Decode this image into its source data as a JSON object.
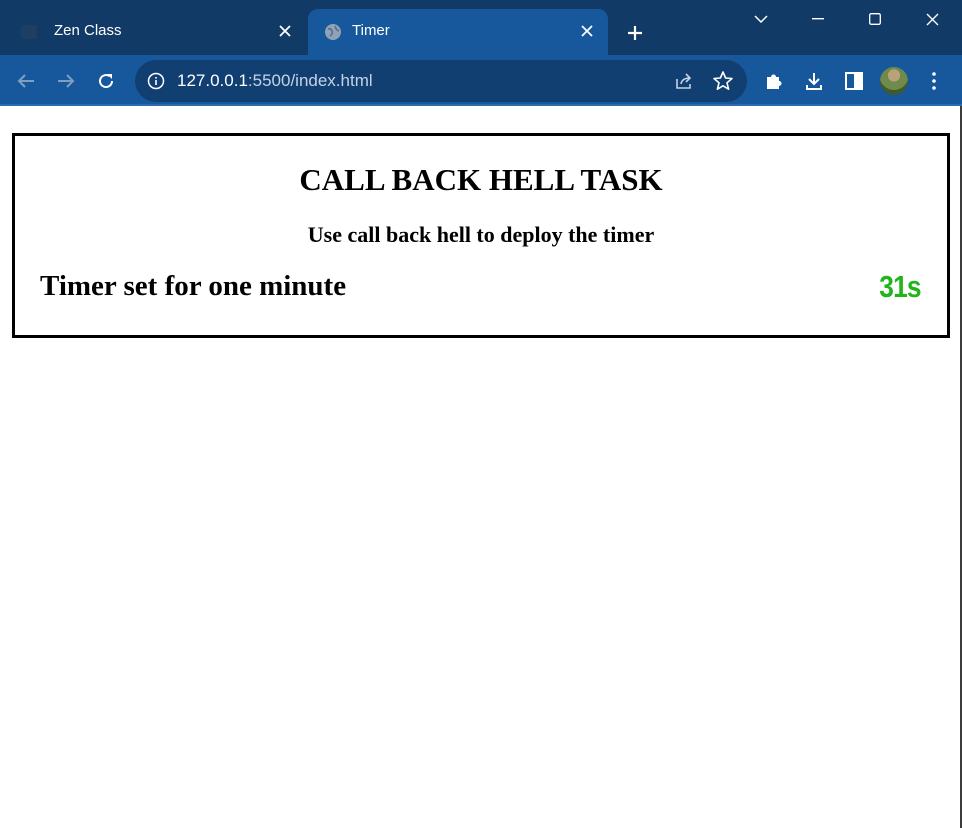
{
  "browser": {
    "tabs": [
      {
        "title": "Zen Class",
        "active": false,
        "favicon": "zen-class-favicon"
      },
      {
        "title": "Timer",
        "active": true,
        "favicon": "globe-icon"
      }
    ],
    "url_host": "127.0.0.1",
    "url_rest": ":5500/index.html",
    "colors": {
      "tabbar": "#123a66",
      "toolbar": "#17589c",
      "omnibox": "#123f72"
    }
  },
  "page": {
    "title": "CALL BACK HELL TASK",
    "subtitle": "Use call back hell to deploy the timer",
    "timer_label": "Timer set for one minute",
    "timer_value": "31s",
    "timer_color": "#22b51b"
  }
}
